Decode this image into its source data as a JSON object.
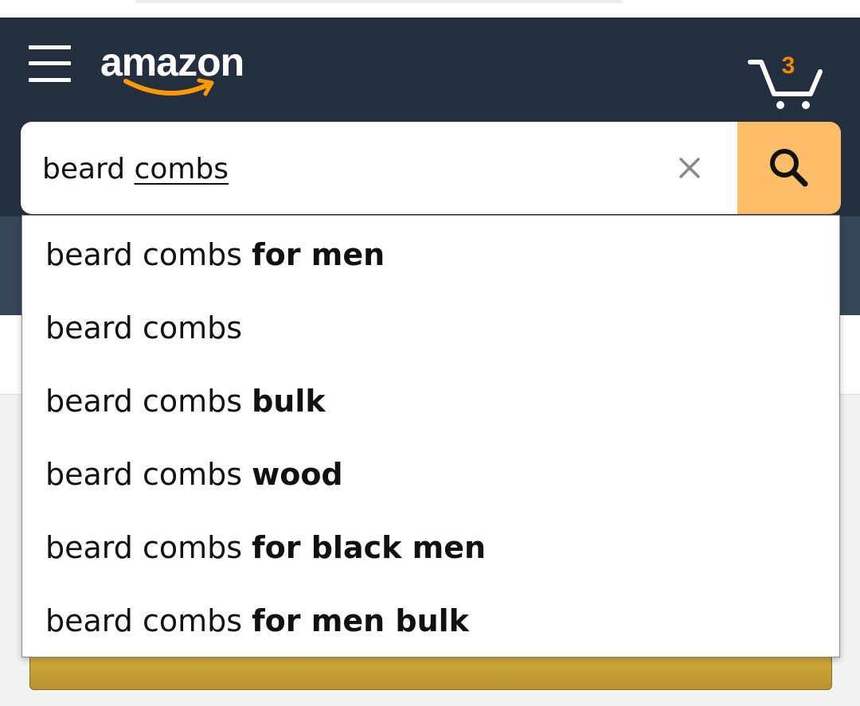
{
  "header": {
    "logo_text": "amazon",
    "cart_count": "3",
    "brand_color": "#232f3e",
    "accent_color": "#ff9900"
  },
  "search": {
    "value_prefix": "beard ",
    "value_underlined": "combs",
    "value": "beard combs",
    "clear_icon": "close-icon",
    "search_icon": "search-icon",
    "button_color": "#febd69"
  },
  "suggestions": [
    {
      "prefix": "beard combs ",
      "bold": "for men"
    },
    {
      "prefix": "beard combs",
      "bold": ""
    },
    {
      "prefix": "beard combs ",
      "bold": "bulk"
    },
    {
      "prefix": "beard combs ",
      "bold": "wood"
    },
    {
      "prefix": "beard combs ",
      "bold": "for black men"
    },
    {
      "prefix": "beard combs ",
      "bold": "for men bulk"
    }
  ]
}
